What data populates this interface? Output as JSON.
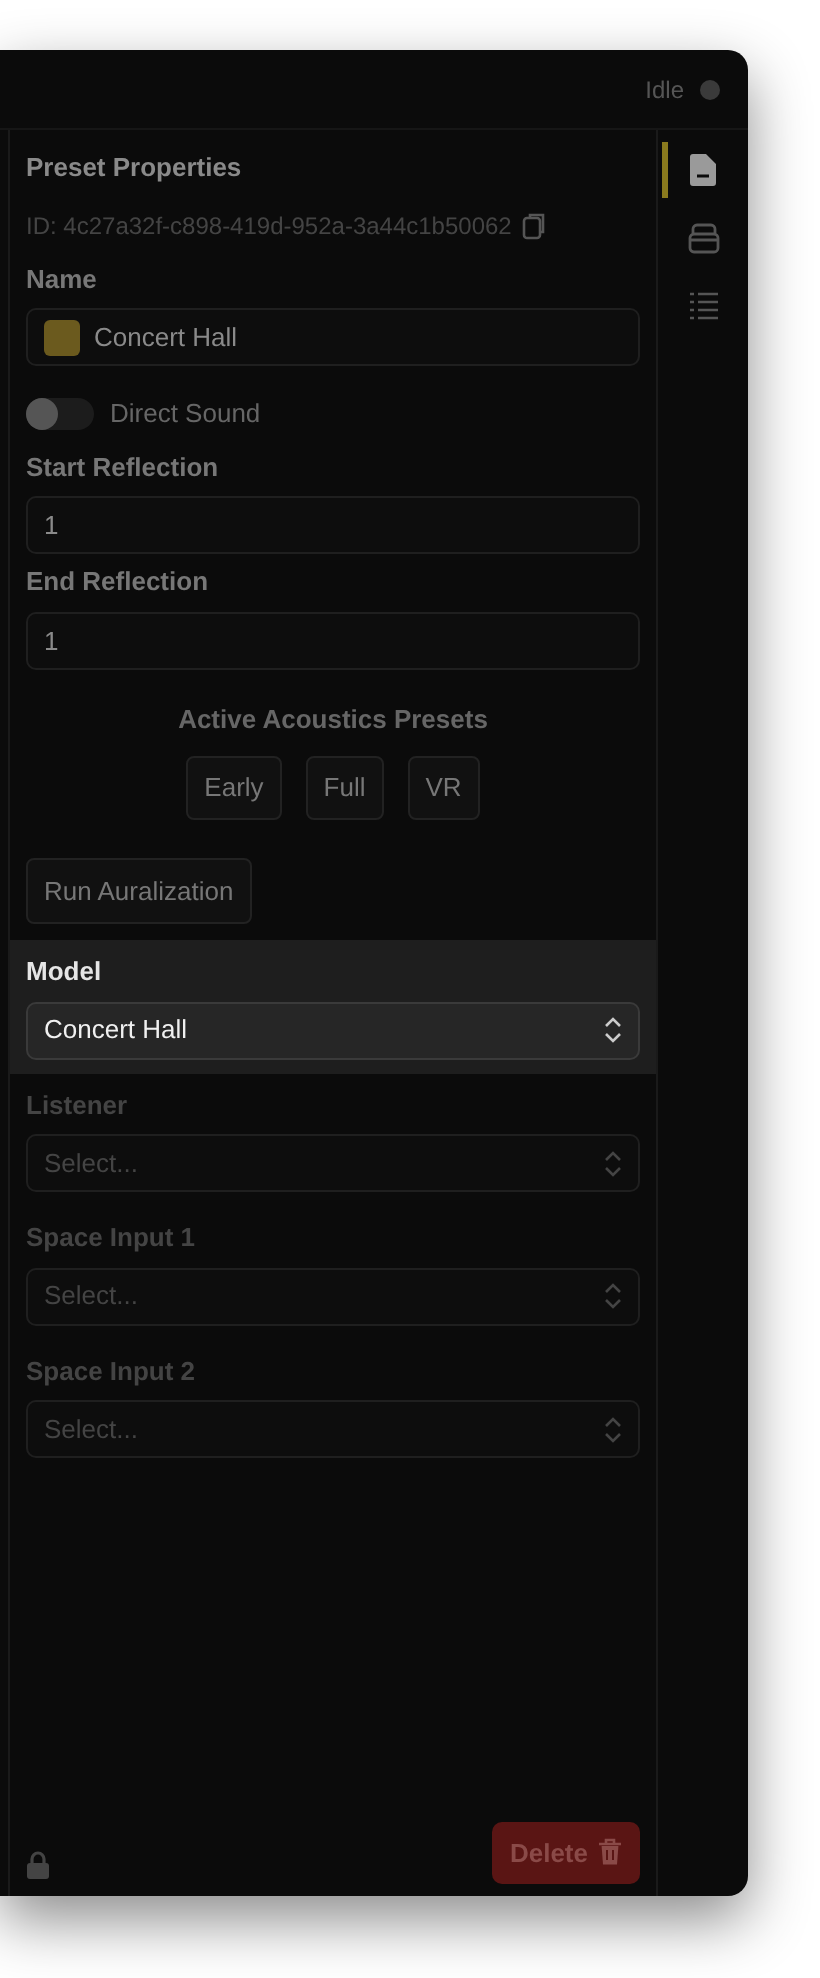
{
  "status": {
    "label": "Idle",
    "active": false
  },
  "panel": {
    "title": "Preset Properties",
    "id_text": "ID: 4c27a32f-c898-419d-952a-3a44c1b50062",
    "fields": [
      {
        "kind": "name",
        "label": "Name",
        "value": "Concert Hall",
        "color": "#6b5a1e"
      },
      {
        "kind": "toggle",
        "label": "Direct Sound",
        "on": false
      },
      {
        "kind": "number",
        "label": "Start Reflection",
        "value": "1"
      },
      {
        "kind": "number",
        "label": "End Reflection",
        "value": "1"
      }
    ],
    "presets": {
      "title": "Active Acoustics Presets",
      "buttons": [
        "Early",
        "Full",
        "VR"
      ]
    },
    "run_button": "Run Auralization",
    "selects": [
      {
        "label": "Model",
        "value": "Concert Hall",
        "selected": true,
        "disabled": false
      },
      {
        "label": "Listener",
        "placeholder": "Select...",
        "selected": false,
        "disabled": true
      },
      {
        "label": "Space Input 1",
        "placeholder": "Select...",
        "selected": false,
        "disabled": true
      },
      {
        "label": "Space Input 2",
        "placeholder": "Select...",
        "selected": false,
        "disabled": true
      }
    ],
    "delete_button": "Delete"
  },
  "sidebar_tabs": [
    {
      "kind": "document",
      "selected": true
    },
    {
      "kind": "stack",
      "selected": false
    },
    {
      "kind": "list",
      "selected": false
    }
  ]
}
